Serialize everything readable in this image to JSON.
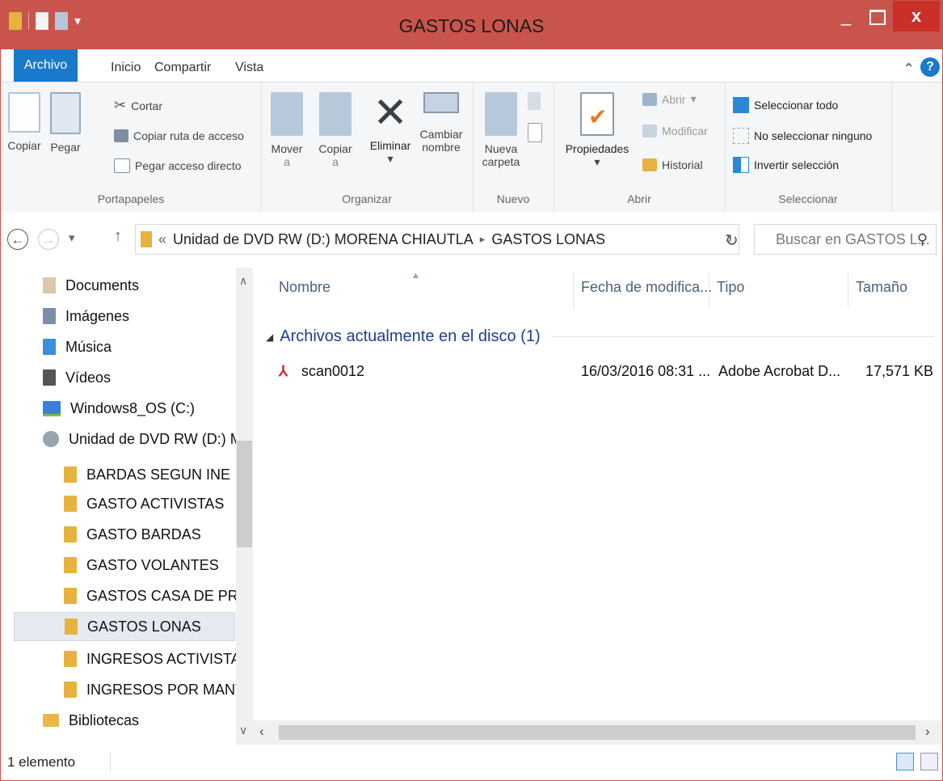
{
  "window": {
    "title": "GASTOS LONAS",
    "minimize": "_",
    "close": "x"
  },
  "tabs": {
    "file": "Archivo",
    "home": "Inicio",
    "share": "Compartir",
    "view": "Vista",
    "help": "?"
  },
  "ribbon": {
    "clipboard": {
      "label": "Portapapeles",
      "copy": "Copiar",
      "paste": "Pegar",
      "cut": "Cortar",
      "copy_path": "Copiar ruta de acceso",
      "paste_shortcut": "Pegar acceso directo"
    },
    "organize": {
      "label": "Organizar",
      "move": "Mover",
      "move_sub": "a",
      "copy": "Copiar",
      "copy_sub": "a",
      "delete": "Eliminar",
      "rename": "Cambiar",
      "rename_sub": "nombre"
    },
    "new": {
      "label": "Nuevo",
      "folder": "Nueva",
      "folder_sub": "carpeta"
    },
    "open": {
      "label": "Abrir",
      "properties": "Propiedades",
      "open": "Abrir",
      "edit": "Modificar",
      "history": "Historial"
    },
    "select": {
      "label": "Seleccionar",
      "all": "Seleccionar todo",
      "none": "No seleccionar ninguno",
      "invert": "Invertir selección"
    }
  },
  "address": {
    "back_chevron": "«",
    "drive": "Unidad de DVD RW (D:) MORENA CHIAUTLA",
    "sep": "▸",
    "folder": "GASTOS LONAS",
    "search_placeholder": "Buscar en GASTOS L..."
  },
  "nav": [
    {
      "label": "Documents",
      "icon": "documents-icon"
    },
    {
      "label": "Imágenes",
      "icon": "pictures-icon"
    },
    {
      "label": "Música",
      "icon": "music-icon"
    },
    {
      "label": "Vídeos",
      "icon": "videos-icon"
    },
    {
      "label": "Windows8_OS (C:)",
      "icon": "drive-icon"
    },
    {
      "label": "Unidad de DVD RW (D:) M",
      "icon": "dvd-icon"
    },
    {
      "label": "BARDAS SEGUN INE",
      "icon": "folder-icon"
    },
    {
      "label": "GASTO ACTIVISTAS",
      "icon": "folder-icon"
    },
    {
      "label": "GASTO BARDAS",
      "icon": "folder-icon"
    },
    {
      "label": "GASTO VOLANTES",
      "icon": "folder-icon"
    },
    {
      "label": "GASTOS CASA DE PRECA",
      "icon": "folder-icon"
    },
    {
      "label": "GASTOS LONAS",
      "icon": "folder-icon",
      "selected": true
    },
    {
      "label": "INGRESOS ACTIVISTAS",
      "icon": "folder-icon"
    },
    {
      "label": "INGRESOS POR MANTAS",
      "icon": "folder-icon"
    },
    {
      "label": "Bibliotecas",
      "icon": "library-icon"
    }
  ],
  "columns": {
    "name": "Nombre",
    "modified": "Fecha de modifica...",
    "type": "Tipo",
    "size": "Tamaño"
  },
  "group": {
    "label": "Archivos actualmente en el disco (1)"
  },
  "files": [
    {
      "name": "scan0012",
      "modified": "16/03/2016 08:31 ...",
      "type": "Adobe Acrobat D...",
      "size": "17,571 KB"
    }
  ],
  "status": {
    "count": "1 elemento"
  }
}
